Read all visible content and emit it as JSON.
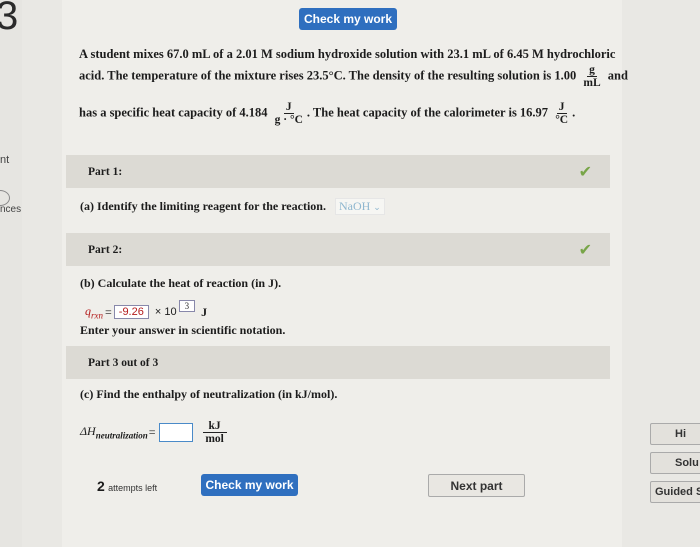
{
  "left_rail": {
    "big_glyph": "3",
    "nt": "nt",
    "nces": "nces"
  },
  "header": {
    "check_button_label": "Check my work"
  },
  "problem": {
    "line1": "A student mixes 67.0 mL of a 2.01 M sodium hydroxide solution with 23.1 mL of 6.45 M hydrochloric",
    "line2_pre": "acid. The temperature of the mixture rises 23.5°C. The density of the resulting solution is 1.00",
    "line2_frac_num": "g",
    "line2_frac_den": "mL",
    "line2_post": "and",
    "line3_pre": "has a specific heat capacity of 4.184",
    "line3_frac1_num": "J",
    "line3_frac1_den": "g · °C",
    "line3_mid": ". The heat capacity of the calorimeter is 16.97",
    "line3_frac2_num": "J",
    "line3_frac2_den": "°C",
    "line3_post": "."
  },
  "parts": [
    {
      "label": "Part 1:",
      "complete": true
    },
    {
      "label": "Part 2:",
      "complete": true
    },
    {
      "label": "Part 3 out of 3",
      "complete": false
    }
  ],
  "part1": {
    "question": "(a) Identify the limiting reagent for the reaction.",
    "selected": "NaOH"
  },
  "part2": {
    "question": "(b) Calculate the heat of reaction (in J).",
    "symbol": "q",
    "symbol_sub": "rxn",
    "equals": "=",
    "mantissa": "-9.26",
    "times_ten": "× 10",
    "exponent": "3",
    "unit": "J",
    "hint": "Enter your answer in scientific notation."
  },
  "part3": {
    "question": "(c) Find the enthalpy of neutralization (in kJ/mol).",
    "symbol": "ΔH",
    "symbol_sub": "neutralization",
    "equals": "=",
    "value": "",
    "unit_num": "kJ",
    "unit_den": "mol"
  },
  "footer": {
    "attempts_count": "2",
    "attempts_label": "attempts left",
    "check_button_label": "Check my work",
    "next_button_label": "Next part"
  },
  "side_panel": {
    "hint": "Hi",
    "solution": "Solu",
    "guided": "Guided S"
  },
  "colors": {
    "accent_blue": "#2f6fbf",
    "check_green": "#78a548",
    "part_bar": "#dcdad4",
    "answer_red": "#b31b1b"
  },
  "icons": {
    "complete": "checkmark-icon",
    "dropdown": "chevron-down-icon"
  }
}
